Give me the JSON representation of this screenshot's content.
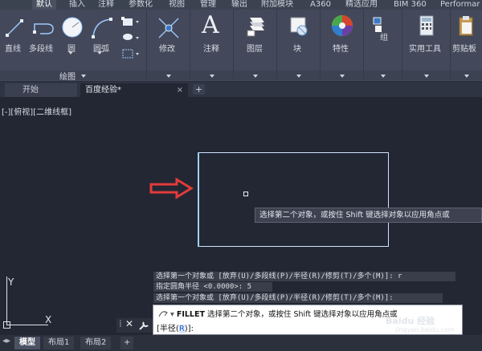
{
  "ribbon_tabs": [
    {
      "label": "默认",
      "active": true
    },
    {
      "label": "插入"
    },
    {
      "label": "注释"
    },
    {
      "label": "参数化"
    },
    {
      "label": "视图"
    },
    {
      "label": "管理"
    },
    {
      "label": "输出"
    },
    {
      "label": "附加模块"
    },
    {
      "label": "A360"
    },
    {
      "label": "精选应用"
    },
    {
      "label": "BIM 360"
    },
    {
      "label": "Performar"
    }
  ],
  "draw_panel": {
    "line": "直线",
    "polyline": "多段线",
    "circle": "圆",
    "arc": "圆弧",
    "footer": "绘图"
  },
  "panels": {
    "modify": "修改",
    "annotation": "注释",
    "layers": "图层",
    "block": "块",
    "properties": "特性",
    "group": "组",
    "utilities": "实用工具",
    "clipboard": "剪贴板"
  },
  "doc_tabs": {
    "start": "开始",
    "current": "百度经验*",
    "close": "×",
    "add": "+"
  },
  "viewport": {
    "view_label": "[-][俯视][二维线框]",
    "tooltip": "选择第二个对象，或按住 Shift 键选择对象以应用角点或"
  },
  "command_history": [
    "选择第一个对象或 [放弃(U)/多段线(P)/半径(R)/修剪(T)/多个(M)]: r",
    "指定圆角半径 <0.0000>: 5",
    "选择第一个对象或 [放弃(U)/多段线(P)/半径(R)/修剪(T)/多个(M)]:"
  ],
  "command_line": {
    "command": "FILLET",
    "prompt": "选择第二个对象，或按住 Shift 键选择对象以应用角点或",
    "option_open": "[半径(",
    "option_key": "R",
    "option_close": ")]:"
  },
  "ucs": {
    "y": "Y",
    "x": "X"
  },
  "layout_tabs": {
    "model": "模型",
    "layout1": "布局1",
    "layout2": "布局2",
    "add": "+"
  },
  "watermark": {
    "text": "Baidu 经验",
    "url": "jingyan.baidu.com"
  },
  "colors": {
    "accent_arrow": "#e23b3b",
    "selection": "#9fd0ff",
    "command_keyword": "#1d5bd6"
  }
}
